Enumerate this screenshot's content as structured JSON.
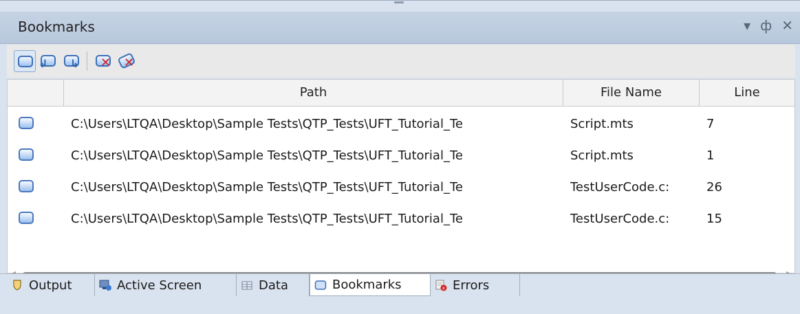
{
  "panel": {
    "title": "Bookmarks",
    "controls": {
      "dropdown": "▾",
      "pin": "ф",
      "close": "✕"
    }
  },
  "toolbar": {
    "buttons": [
      {
        "name": "toggle-bookmark-button",
        "icon": "bookmark-icon",
        "active": true
      },
      {
        "name": "previous-bookmark-button",
        "icon": "previous-bookmark-icon"
      },
      {
        "name": "next-bookmark-button",
        "icon": "next-bookmark-icon"
      },
      {
        "name": "delete-bookmark-button",
        "icon": "delete-bookmark-icon"
      },
      {
        "name": "delete-all-bookmarks-button",
        "icon": "delete-all-bookmarks-icon"
      }
    ]
  },
  "grid": {
    "columns": [
      "",
      "Path",
      "File Name",
      "Line"
    ],
    "rows": [
      {
        "path": "C:\\Users\\LTQA\\Desktop\\Sample Tests\\QTP_Tests\\UFT_Tutorial_Te",
        "file": "Script.mts",
        "line": "7"
      },
      {
        "path": "C:\\Users\\LTQA\\Desktop\\Sample Tests\\QTP_Tests\\UFT_Tutorial_Te",
        "file": "Script.mts",
        "line": "1"
      },
      {
        "path": "C:\\Users\\LTQA\\Desktop\\Sample Tests\\QTP_Tests\\UFT_Tutorial_Te",
        "file": "TestUserCode.c:",
        "line": "26"
      },
      {
        "path": "C:\\Users\\LTQA\\Desktop\\Sample Tests\\QTP_Tests\\UFT_Tutorial_Te",
        "file": "TestUserCode.c:",
        "line": "15"
      }
    ]
  },
  "tabs": [
    {
      "label": "Output",
      "icon": "output-icon"
    },
    {
      "label": "Active Screen",
      "icon": "active-screen-icon"
    },
    {
      "label": "Data",
      "icon": "data-table-icon"
    },
    {
      "label": "Bookmarks",
      "icon": "bookmark-icon",
      "active": true
    },
    {
      "label": "Errors",
      "icon": "errors-icon"
    }
  ],
  "colors": {
    "accent": "#3d6fb8",
    "panel_bg": "#d9e3ef",
    "delete_red": "#d32222"
  }
}
